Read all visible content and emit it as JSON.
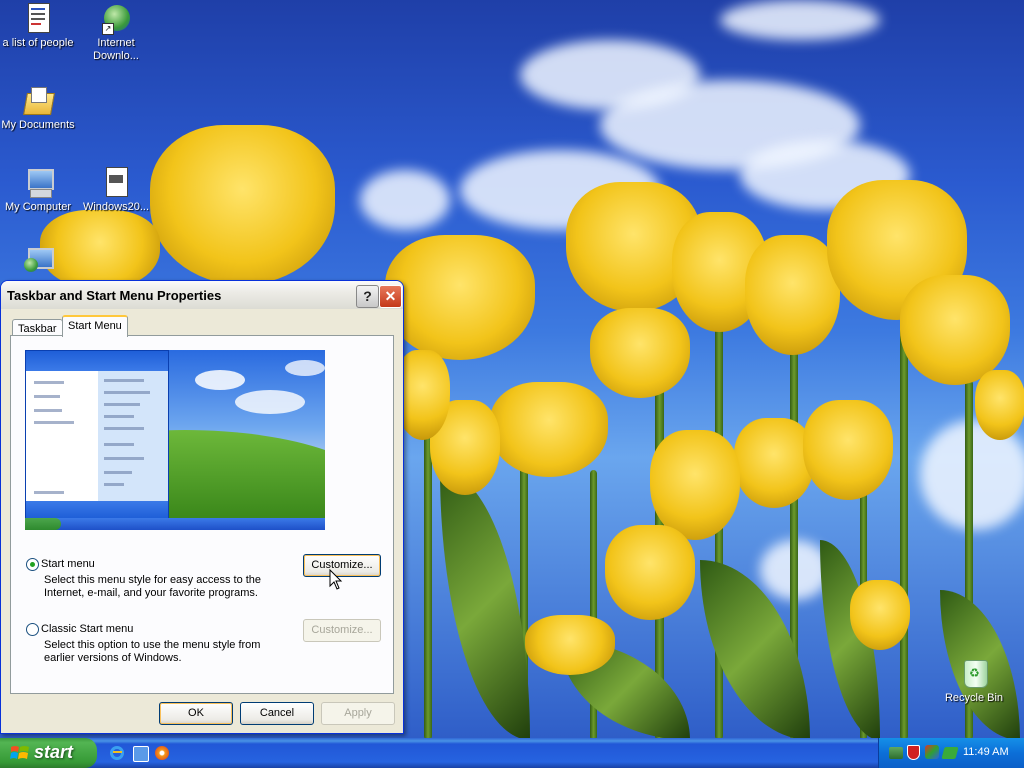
{
  "desktop": {
    "icons": [
      {
        "label": "a list of people",
        "icon": "document-icon"
      },
      {
        "label": "Internet\nDownlo...",
        "icon": "internet-download-icon"
      },
      {
        "label": "My Documents",
        "icon": "my-documents-folder-icon"
      },
      {
        "label": "My Computer",
        "icon": "my-computer-icon"
      },
      {
        "label": "Windows20...",
        "icon": "file-icon"
      },
      {
        "label": "Recycle Bin",
        "icon": "recycle-bin-icon"
      }
    ]
  },
  "dialog": {
    "title": "Taskbar and Start Menu Properties",
    "help_glyph": "?",
    "close_glyph": "✕",
    "tabs": [
      "Taskbar",
      "Start Menu"
    ],
    "active_tab": "Start Menu",
    "options": [
      {
        "label": "Start menu",
        "selected": true,
        "desc_line1": "Select this menu style for easy access to the",
        "desc_line2": "Internet, e-mail, and your favorite programs.",
        "customize": "Customize...",
        "customize_enabled": true
      },
      {
        "label": "Classic Start menu",
        "selected": false,
        "desc_line1": "Select this option to use the menu style from",
        "desc_line2": "earlier versions of Windows.",
        "customize": "Customize...",
        "customize_enabled": false
      }
    ],
    "buttons": {
      "ok": "OK",
      "cancel": "Cancel",
      "apply": "Apply"
    }
  },
  "taskbar": {
    "start_label": "start",
    "clock": "11:49 AM",
    "quick_launch": [
      "internet-explorer-icon",
      "media-icon",
      "media-player-icon"
    ],
    "tray_icons": [
      "network-icon",
      "security-shield-icon",
      "tray-app-icon",
      "safely-remove-icon"
    ]
  },
  "colors": {
    "titlebar_close": "#c4381a",
    "start_green": "#3c9a3c",
    "taskbar_blue": "#2663e0"
  }
}
